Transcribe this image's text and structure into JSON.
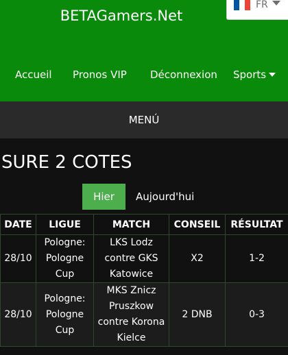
{
  "header": {
    "site_title": "BETAGamers.Net",
    "language": {
      "code": "FR",
      "flag_colors": [
        "#0055a4",
        "#ffffff",
        "#ef4135"
      ]
    },
    "brand_color": "#0a8a0a"
  },
  "nav": {
    "items": [
      {
        "label": "Accueil"
      },
      {
        "label": "Pronos VIP"
      },
      {
        "label": "Déconnexion"
      },
      {
        "label": "Sports"
      }
    ]
  },
  "menu": {
    "label": "MENÚ"
  },
  "main": {
    "title": "SURE 2 COTES",
    "tabs": [
      {
        "label": "Hier",
        "active": true
      },
      {
        "label": "Aujourd'hui",
        "active": false
      }
    ],
    "active_tab_color": "#4cae4c",
    "table": {
      "headers": [
        "DATE",
        "LIGUE",
        "MATCH",
        "CONSEIL",
        "RÉSULTAT"
      ],
      "rows": [
        {
          "date": "28/10",
          "league": "Pologne: Pologne Cup",
          "match": "LKS Lodz contre GKS Katowice",
          "tip": "X2",
          "result": "1-2"
        },
        {
          "date": "28/10",
          "league": "Pologne: Pologne Cup",
          "match": "MKS Znicz Pruszkow contre Korona Kielce",
          "tip": "2 DNB",
          "result": "0-3"
        }
      ]
    }
  }
}
